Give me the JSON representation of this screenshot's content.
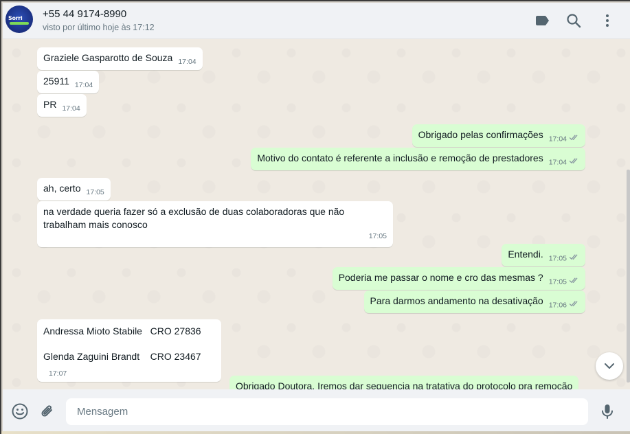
{
  "header": {
    "contact_name": "+55 44 9174-8990",
    "status": "visto por último hoje às 17:12",
    "avatar_logo_text": "Sorri"
  },
  "icons": {
    "label": "label-icon",
    "search": "search-icon",
    "menu": "kebab-menu-icon",
    "emoji": "emoji-icon",
    "attach": "paperclip-icon",
    "mic": "microphone-icon",
    "scroll": "chevron-down-icon",
    "read": "double-check-icon"
  },
  "colors": {
    "incoming": "#ffffff",
    "outgoing": "#d9fdd3",
    "read_tick": "#53bdeb",
    "header_bg": "#f0f2f5"
  },
  "messages": [
    {
      "dir": "in",
      "text": "Graziele Gasparotto de Souza",
      "time": "17:04"
    },
    {
      "dir": "in",
      "text": "25911",
      "time": "17:04"
    },
    {
      "dir": "in",
      "text": "PR",
      "time": "17:04"
    },
    {
      "dir": "out",
      "text": "Obrigado pelas confirmações",
      "time": "17:04"
    },
    {
      "dir": "out",
      "text": "Motivo do contato é referente a inclusão e remoção de prestadores",
      "time": "17:04"
    },
    {
      "dir": "in",
      "text": "ah, certo",
      "time": "17:05"
    },
    {
      "dir": "in",
      "text": "na verdade queria fazer só a exclusão de duas colaboradoras que não trabalham mais conosco",
      "time": "17:05"
    },
    {
      "dir": "out",
      "text": "Entendi.",
      "time": "17:05"
    },
    {
      "dir": "out",
      "text": "Poderia me passar o nome e cro das mesmas ?",
      "time": "17:05"
    },
    {
      "dir": "out",
      "text": "Para darmos andamento na desativação",
      "time": "17:06"
    },
    {
      "dir": "in",
      "line1": "Andressa Mioto Stabile   CRO 27836",
      "line2": "Glenda Zaguini Brandt    CRO 23467",
      "time": "17:07"
    },
    {
      "dir": "out",
      "text": "Obrigado Doutora. Iremos dar sequencia na tratativa do protocolo pra remoção"
    }
  ],
  "composer": {
    "placeholder": "Mensagem"
  }
}
